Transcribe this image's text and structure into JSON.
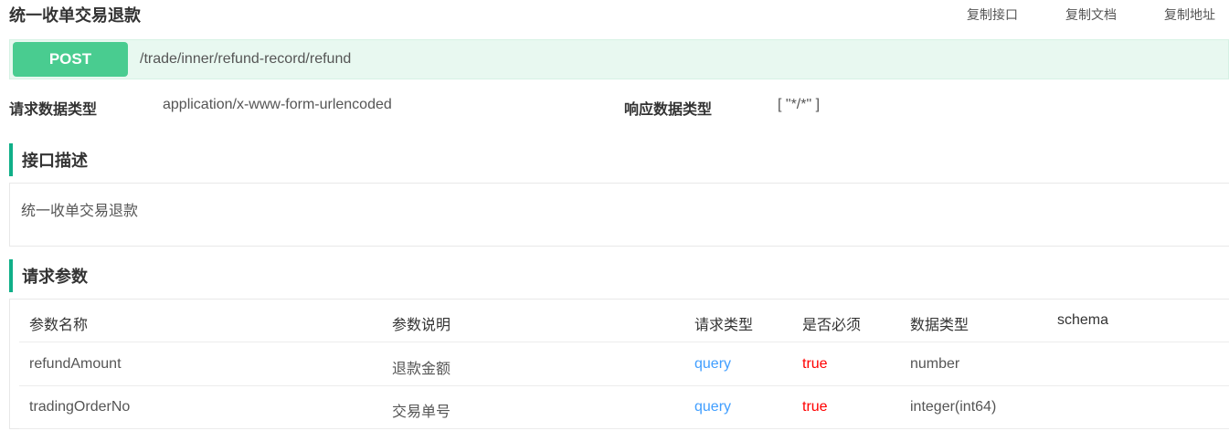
{
  "header": {
    "title": "统一收单交易退款",
    "actions": [
      "复制接口",
      "复制文档",
      "复制地址"
    ]
  },
  "endpoint": {
    "method": "POST",
    "path": "/trade/inner/refund-record/refund"
  },
  "meta": {
    "request_label": "请求数据类型",
    "request_value": "application/x-www-form-urlencoded",
    "response_label": "响应数据类型",
    "response_value": "[ \"*/*\" ]"
  },
  "description": {
    "heading": "接口描述",
    "text": "统一收单交易退款"
  },
  "params": {
    "heading": "请求参数",
    "columns": [
      "参数名称",
      "参数说明",
      "请求类型",
      "是否必须",
      "数据类型",
      "schema"
    ],
    "rows": [
      [
        "refundAmount",
        "退款金额",
        "query",
        "true",
        "number",
        ""
      ],
      [
        "tradingOrderNo",
        "交易单号",
        "query",
        "true",
        "integer(int64)",
        ""
      ]
    ]
  },
  "colors": {
    "post_badge": "#49cc90",
    "url_bar_bg": "#e8f8f0",
    "section_accent": "#10af88",
    "query": "#409eff",
    "required_true": "#ff0000"
  }
}
